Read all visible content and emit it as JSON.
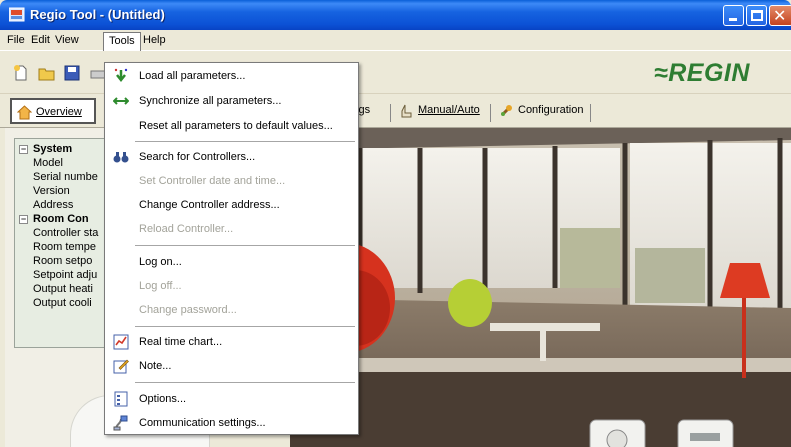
{
  "window": {
    "title": "Regio Tool - (Untitled)",
    "controls": [
      "minimize-icon",
      "maximize-icon",
      "close-icon"
    ]
  },
  "menubar": {
    "items": [
      {
        "label": "File",
        "active": false
      },
      {
        "label": "Edit",
        "active": false
      },
      {
        "label": "View",
        "active": false
      },
      {
        "label": "Tools",
        "active": true
      },
      {
        "label": "Help",
        "active": false
      }
    ]
  },
  "toolbar": {
    "buttons": [
      "new-icon",
      "open-icon",
      "save-icon",
      "print-icon"
    ],
    "logo": "≈REGIN"
  },
  "tabs": [
    {
      "label": "Overview",
      "icon": "home-icon",
      "active": true
    },
    {
      "label": "ings",
      "icon": "",
      "active": false
    },
    {
      "label": "Manual/Auto",
      "icon": "hand-icon",
      "active": false
    },
    {
      "label": "Configuration",
      "icon": "wrench-icon",
      "active": false
    }
  ],
  "tree": {
    "system_header": "System",
    "system_items": [
      "Model",
      "Serial numbe",
      "Version",
      "Address"
    ],
    "room_header": "Room Con",
    "room_items": [
      "Controller sta",
      "Room tempe",
      "Room setpo",
      "Setpoint adju",
      "Output heati",
      "Output cooli"
    ]
  },
  "tools_menu": {
    "groups": [
      [
        {
          "label": "Load all parameters...",
          "icon": "download-arrow-icon",
          "enabled": true
        },
        {
          "label": "Synchronize all parameters...",
          "icon": "sync-arrows-icon",
          "enabled": true
        },
        {
          "label": "Reset all parameters to default values...",
          "icon": "",
          "enabled": true
        }
      ],
      [
        {
          "label": "Search for Controllers...",
          "icon": "binoculars-icon",
          "enabled": true
        },
        {
          "label": "Set Controller date and time...",
          "icon": "",
          "enabled": false
        },
        {
          "label": "Change Controller address...",
          "icon": "",
          "enabled": true
        },
        {
          "label": "Reload Controller...",
          "icon": "",
          "enabled": false
        }
      ],
      [
        {
          "label": "Log on...",
          "icon": "",
          "enabled": true
        },
        {
          "label": "Log off...",
          "icon": "",
          "enabled": false
        },
        {
          "label": "Change password...",
          "icon": "",
          "enabled": false
        }
      ],
      [
        {
          "label": "Real time chart...",
          "icon": "chart-icon",
          "enabled": true
        },
        {
          "label": "Note...",
          "icon": "note-icon",
          "enabled": true
        }
      ],
      [
        {
          "label": "Options...",
          "icon": "options-icon",
          "enabled": true
        },
        {
          "label": "Communication settings...",
          "icon": "communication-icon",
          "enabled": true
        }
      ]
    ]
  },
  "colors": {
    "titlebar": "#0c52d6",
    "logo_green": "#2e7d32",
    "chair_red": "#d6321e"
  }
}
